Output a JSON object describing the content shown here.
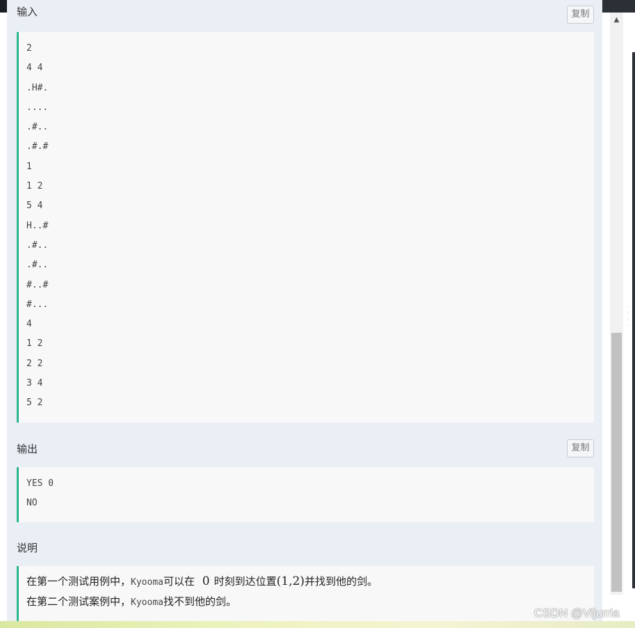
{
  "sections": {
    "input": {
      "title": "输入",
      "copy_label": "复制",
      "lines": [
        "2",
        "4 4",
        ".H#.",
        "....",
        ".#..",
        ".#.#",
        "1",
        "1 2",
        "5 4",
        "H..#",
        ".#..",
        ".#..",
        "#..#",
        "#...",
        "4",
        "1 2",
        "2 2",
        "3 4",
        "5 2"
      ]
    },
    "output": {
      "title": "输出",
      "copy_label": "复制",
      "lines": [
        "YES 0",
        "NO"
      ]
    },
    "explanation": {
      "title": "说明",
      "line1": {
        "pre": "在第一个测试用例中，",
        "name": "Kyooma",
        "mid": "可以在",
        "time": "0",
        "mid2": "时刻到达位置",
        "pos": "(1,2)",
        "post": "并找到他的剑。"
      },
      "line2": {
        "pre": "在第二个测试案例中，",
        "name": "Kyooma",
        "post": "找不到他的剑。"
      }
    }
  },
  "watermark": "CSDN @Vijurria"
}
